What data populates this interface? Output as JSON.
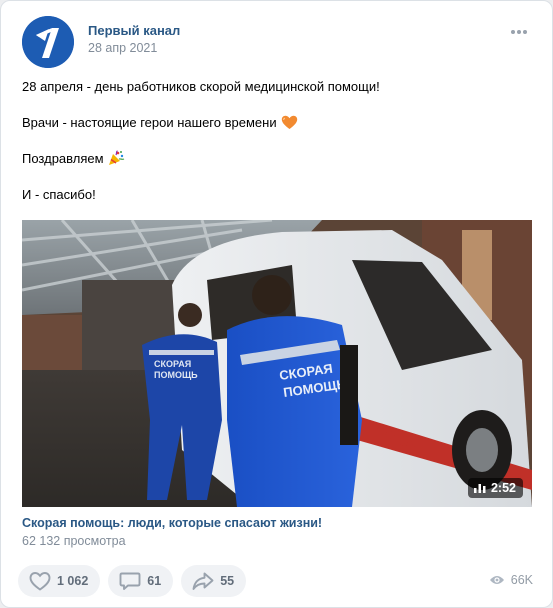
{
  "post": {
    "author": "Первый канал",
    "date": "28 апр 2021",
    "text": {
      "line1": "28 апреля - день работников скорой медицинской помощи!",
      "line2": "Врачи - настоящие герои нашего времени",
      "line3": "Поздравляем",
      "line4": "И - спасибо!"
    },
    "emojis": {
      "line2": "orange-heart-icon",
      "line3": "party-popper-icon"
    }
  },
  "video": {
    "duration": "2:52",
    "title": "Скорая помощь: люди, которые спасают жизни!",
    "views": "62 132 просмотра",
    "overlay_text": {
      "back": "СКОРАЯ\nПОМОЩЬ",
      "front1": "СКОРАЯ",
      "front2": "ПОМОЩЬ",
      "van": "ОЩЬ"
    }
  },
  "actions": {
    "likes": "1 062",
    "comments": "61",
    "shares": "55",
    "views": "66K"
  },
  "colors": {
    "link": "#2a5885",
    "secondary": "#818c99",
    "action_bg": "#f0f2f5",
    "action_text": "#626d7a",
    "avatar_bg": "#1d5cb3"
  }
}
